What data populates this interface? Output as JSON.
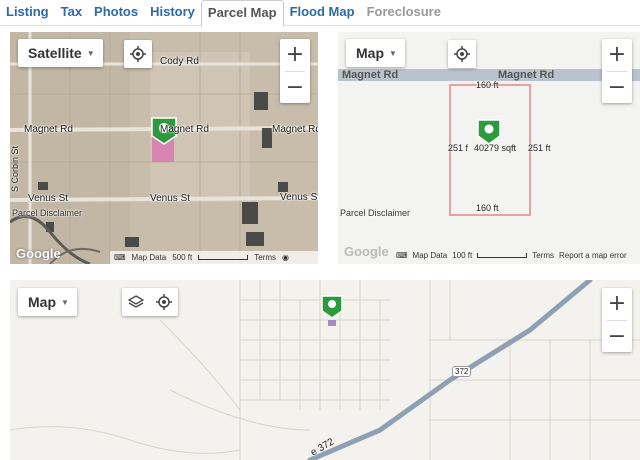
{
  "tabs": [
    {
      "label": "Listing",
      "state": "normal"
    },
    {
      "label": "Tax",
      "state": "normal"
    },
    {
      "label": "Photos",
      "state": "normal"
    },
    {
      "label": "History",
      "state": "normal"
    },
    {
      "label": "Parcel Map",
      "state": "active"
    },
    {
      "label": "Flood Map",
      "state": "normal"
    },
    {
      "label": "Foreclosure",
      "state": "disabled"
    }
  ],
  "satellite": {
    "type_label": "Satellite",
    "roads": {
      "cody": "Cody Rd",
      "magnet_left": "Magnet Rd",
      "magnet_mid": "Magnet Rd",
      "magnet_right": "Magnet Rd",
      "venus_left": "Venus St",
      "venus_mid": "Venus St",
      "venus_right": "Venus St",
      "corbin": "S Corbin St"
    },
    "disclaimer": "Parcel Disclaimer",
    "google": "Google",
    "map_data": "Map Data",
    "scale": "500 ft",
    "terms": "Terms"
  },
  "parcel": {
    "type_label": "Map",
    "road_left": "Magnet Rd",
    "road_right": "Magnet Rd",
    "top_dim": "160 ft",
    "bottom_dim": "160 ft",
    "left_dim": "251 f",
    "right_dim": "251 ft",
    "area": "40279 sqft",
    "disclaimer": "Parcel Disclaimer",
    "google": "Google",
    "map_data": "Map Data",
    "scale": "100 ft",
    "terms": "Terms",
    "report": "Report a map error"
  },
  "flood": {
    "type_label": "Map",
    "highway_shield": "372",
    "highway_label": "e 372"
  },
  "zoom": {
    "in": "+",
    "out": "−"
  },
  "colors": {
    "tab_link": "#2d6aa6",
    "pin": "#2e9a3e",
    "parcel_outline": "#e8a0a0",
    "highway": "#8ea0b4"
  }
}
